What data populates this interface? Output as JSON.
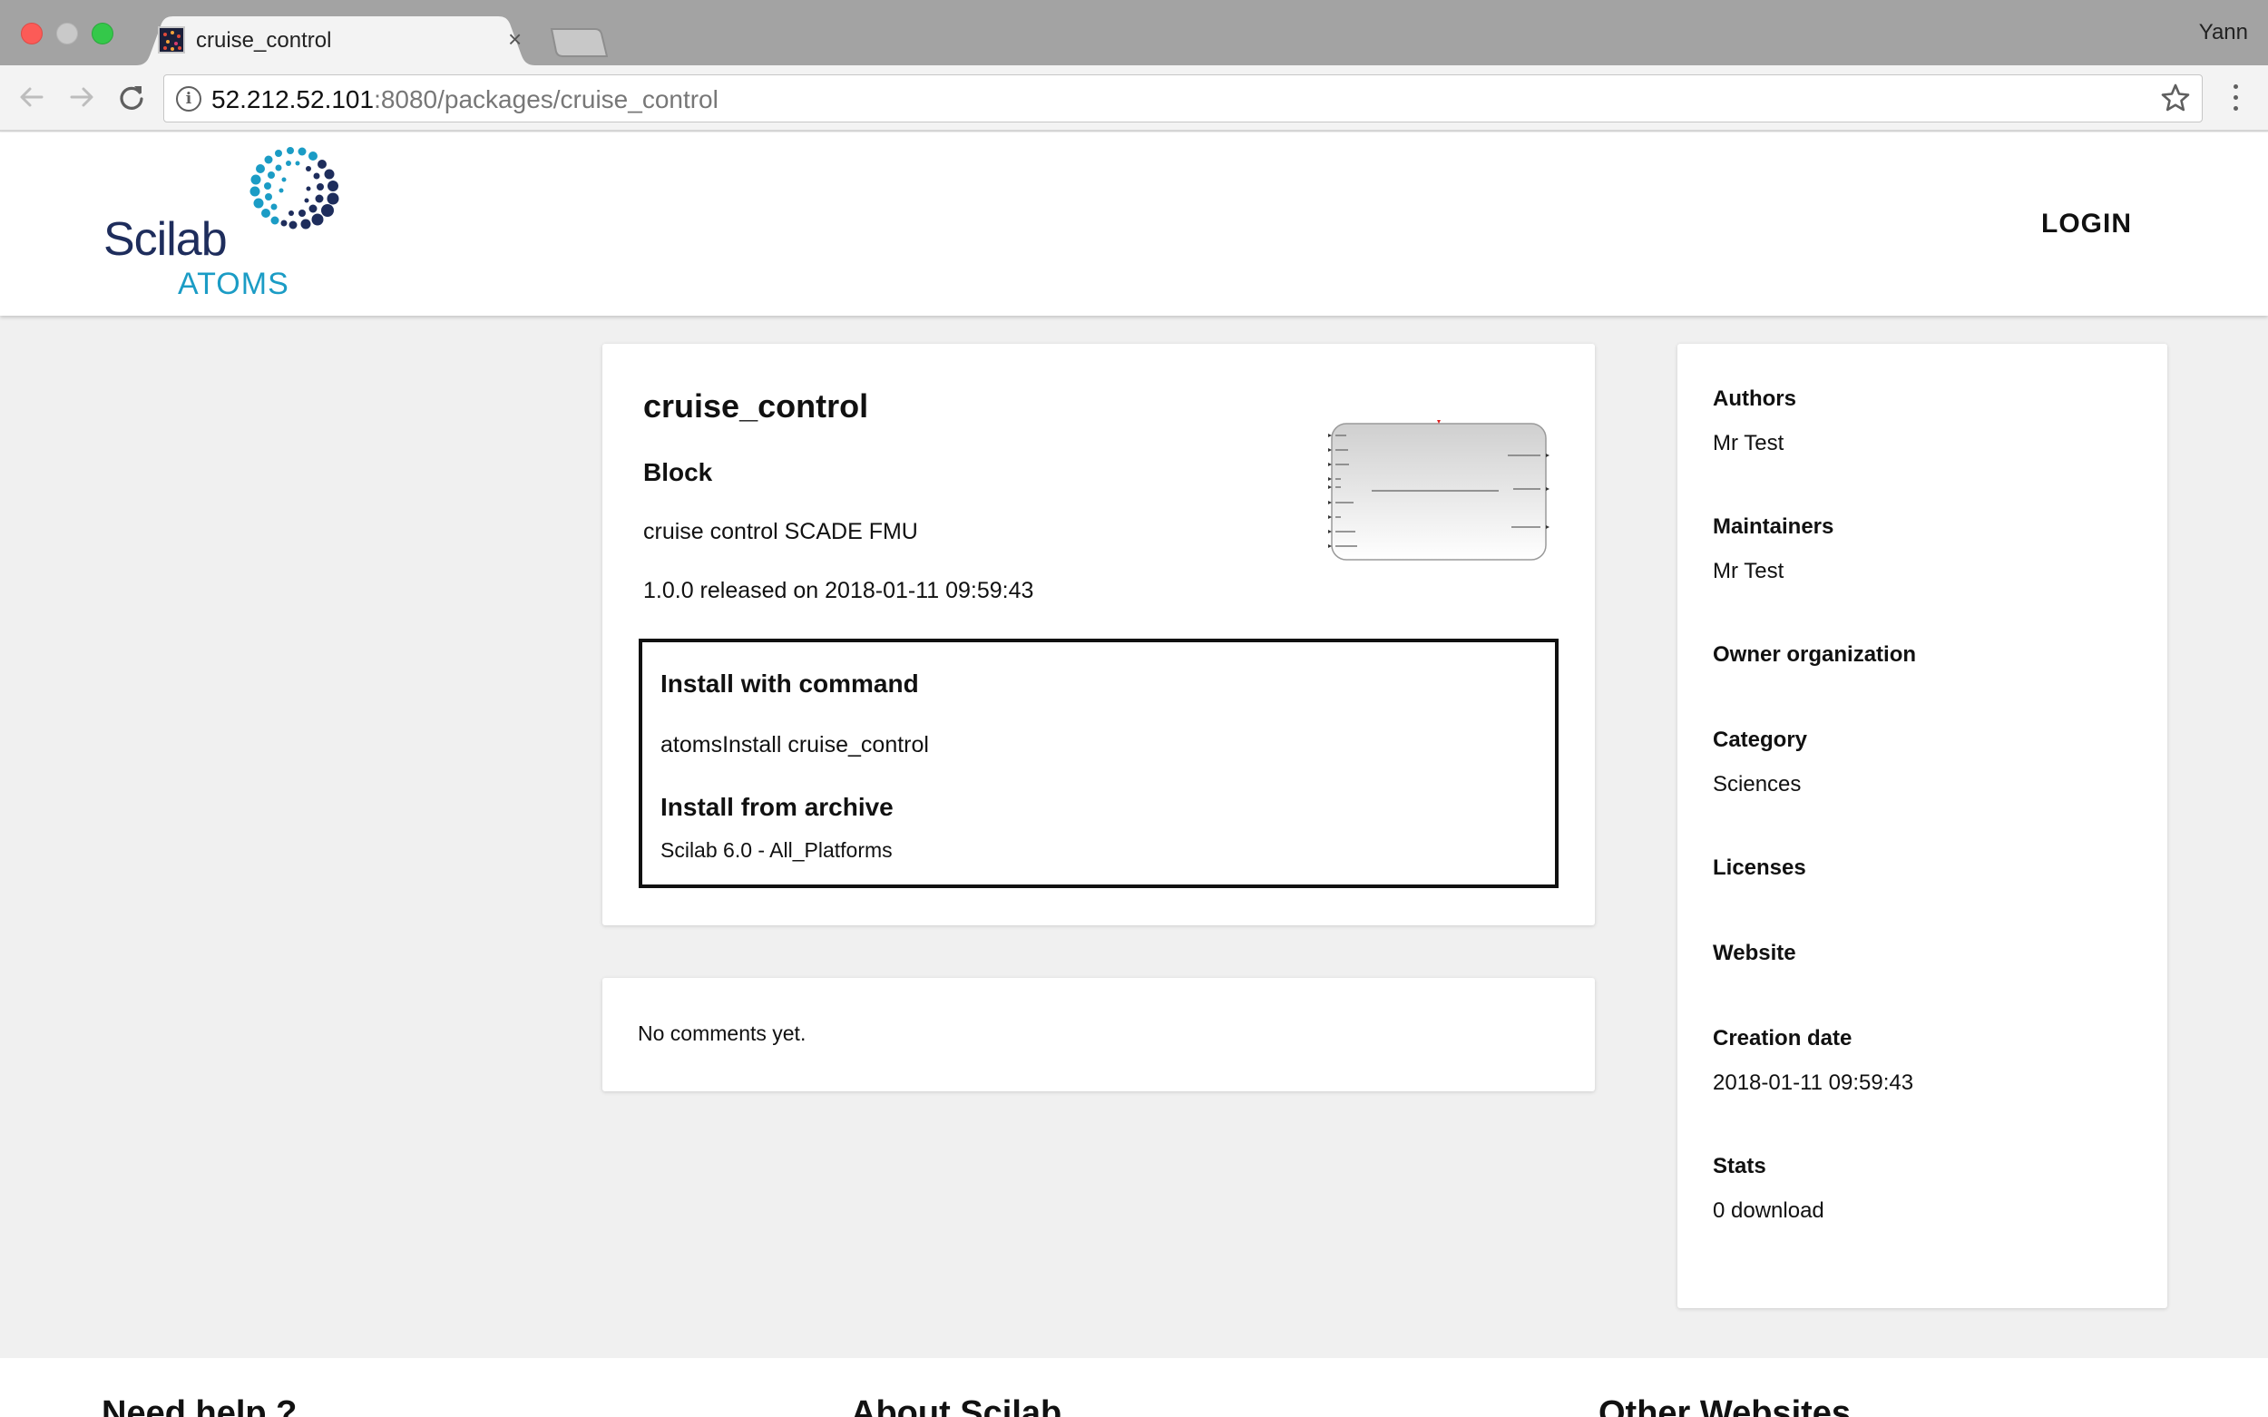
{
  "browser": {
    "tab_title": "cruise_control",
    "tab_close": "×",
    "profile_name": "Yann",
    "url_host": "52.212.52.101",
    "url_rest": ":8080/packages/cruise_control"
  },
  "header": {
    "logo_scilab": "Scilab",
    "logo_atoms": "ATOMS",
    "login_label": "LOGIN"
  },
  "package": {
    "name": "cruise_control",
    "type": "Block",
    "description": "cruise control SCADE FMU",
    "release": "1.0.0 released on 2018-01-11 09:59:43",
    "install_command_heading": "Install with command",
    "install_command": "atomsInstall cruise_control",
    "install_archive_heading": "Install from archive",
    "archive_link": "Scilab 6.0 - All_Platforms"
  },
  "comments": {
    "text": "No comments yet."
  },
  "sidebar": {
    "fields": [
      {
        "label": "Authors",
        "value": "Mr Test"
      },
      {
        "label": "Maintainers",
        "value": "Mr Test"
      },
      {
        "label": "Owner organization",
        "value": ""
      },
      {
        "label": "Category",
        "value": "Sciences"
      },
      {
        "label": "Licenses",
        "value": ""
      },
      {
        "label": "Website",
        "value": ""
      },
      {
        "label": "Creation date",
        "value": "2018-01-11 09:59:43"
      },
      {
        "label": "Stats",
        "value": "0 download"
      }
    ]
  },
  "footer": {
    "col1": "Need help ?",
    "col2": "About Scilab",
    "col3": "Other Websites"
  },
  "colors": {
    "brand_dark": "#1e2d5c",
    "brand_light": "#1b9cc5",
    "page_bg": "#f0f0f0"
  }
}
